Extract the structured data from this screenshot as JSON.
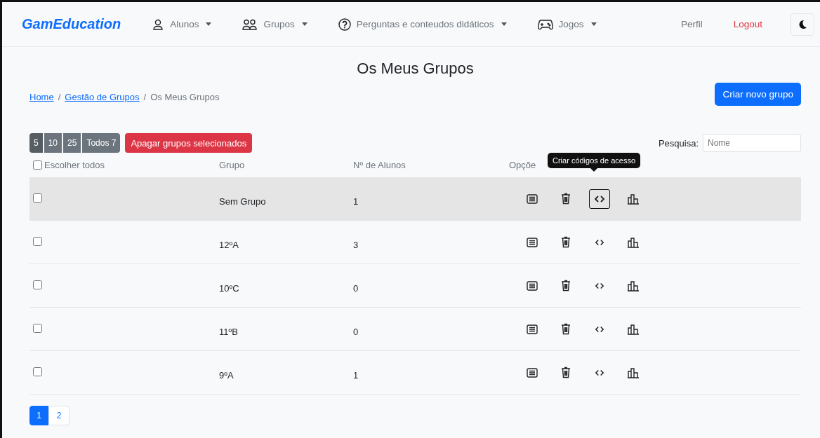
{
  "navbar": {
    "brand": "GamEducation",
    "menus": [
      {
        "label": "Alunos"
      },
      {
        "label": "Grupos"
      },
      {
        "label": "Perguntas e conteudos didáticos"
      },
      {
        "label": "Jogos"
      }
    ],
    "links": [
      {
        "label": "Perfil",
        "kind": "plain"
      },
      {
        "label": "Logout",
        "kind": "danger"
      }
    ]
  },
  "title": "Os Meus Grupos",
  "breadcrumb": [
    {
      "label": "Home",
      "link": true
    },
    {
      "label": "Gestão de Grupos",
      "link": true
    },
    {
      "label": "Os Meus Grupos",
      "link": false
    }
  ],
  "breadcrumb_separators": [
    "/",
    "/"
  ],
  "create_button": "Criar novo grupo",
  "page_sizes": [
    {
      "label": "5",
      "selected": true
    },
    {
      "label": "10",
      "selected": false
    },
    {
      "label": "25",
      "selected": false
    },
    {
      "label": "Todos 7",
      "selected": false
    }
  ],
  "delete_button": "Apagar grupos selecionados",
  "search": {
    "label": "Pesquisa:",
    "placeholder": "Nome"
  },
  "table": {
    "select_all": {
      "label": "Escolher todos",
      "checked": false
    },
    "columns": [
      "Grupo",
      "Nº de Alunos",
      "Opçõe"
    ],
    "rows": [
      {
        "group": "Sem Grupo",
        "students": "1",
        "checked": false,
        "highlighted": true
      },
      {
        "group": "12ºA",
        "students": "3",
        "checked": false,
        "highlighted": false
      },
      {
        "group": "10ºC",
        "students": "0",
        "checked": false,
        "highlighted": false
      },
      {
        "group": "11ºB",
        "students": "0",
        "checked": false,
        "highlighted": false
      },
      {
        "group": "9ºA",
        "students": "1",
        "checked": false,
        "highlighted": false
      }
    ]
  },
  "tooltip": "Criar códigos de acesso",
  "pagination": [
    {
      "label": "1",
      "selected": true
    },
    {
      "label": "2",
      "selected": false
    }
  ]
}
